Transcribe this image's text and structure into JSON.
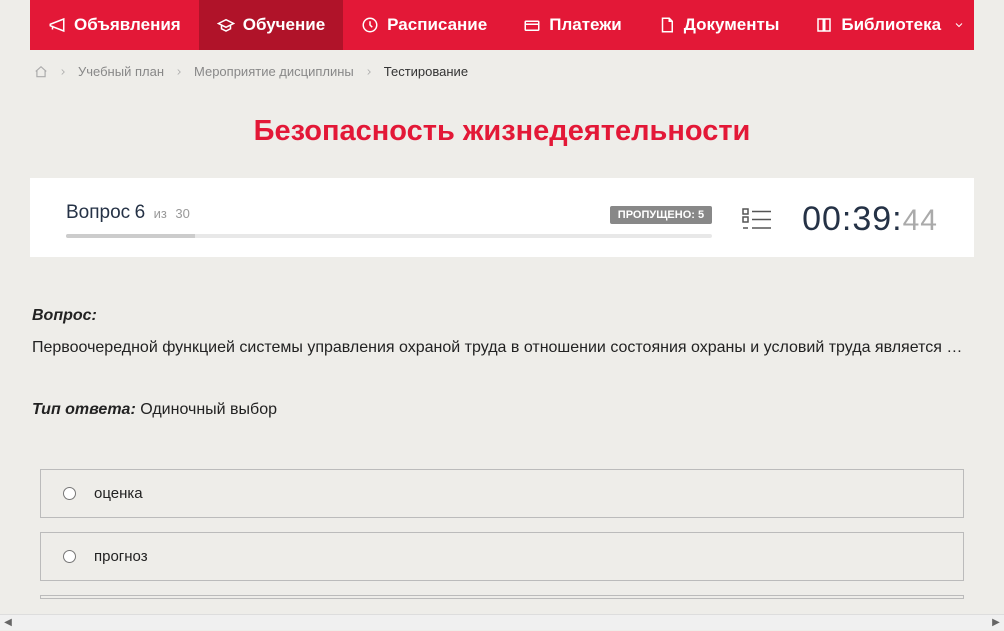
{
  "nav": {
    "items": [
      {
        "label": "Объявления",
        "icon": "megaphone"
      },
      {
        "label": "Обучение",
        "icon": "graduation",
        "active": true
      },
      {
        "label": "Расписание",
        "icon": "clock"
      },
      {
        "label": "Платежи",
        "icon": "payment"
      },
      {
        "label": "Документы",
        "icon": "document"
      },
      {
        "label": "Библиотека",
        "icon": "book",
        "dropdown": true
      }
    ]
  },
  "breadcrumb": {
    "items": [
      {
        "label": "Учебный план"
      },
      {
        "label": "Мероприятие дисциплины"
      }
    ],
    "current": "Тестирование"
  },
  "page_title": "Безопасность жизнедеятельности",
  "question_panel": {
    "question_word": "Вопрос",
    "question_num": "6",
    "total_prefix": "из",
    "total_num": "30",
    "skipped_label": "ПРОПУЩЕНО: 5",
    "timer_main": "00:39:",
    "timer_ms": "44"
  },
  "question": {
    "label": "Вопрос:",
    "text": "Первоочередной функцией системы управления охраной труда в отношении состояния охраны и условий труда является …",
    "answer_type_label": "Тип ответа:",
    "answer_type_value": "Одиночный выбор",
    "options": [
      {
        "label": "оценка"
      },
      {
        "label": "прогноз"
      }
    ]
  }
}
